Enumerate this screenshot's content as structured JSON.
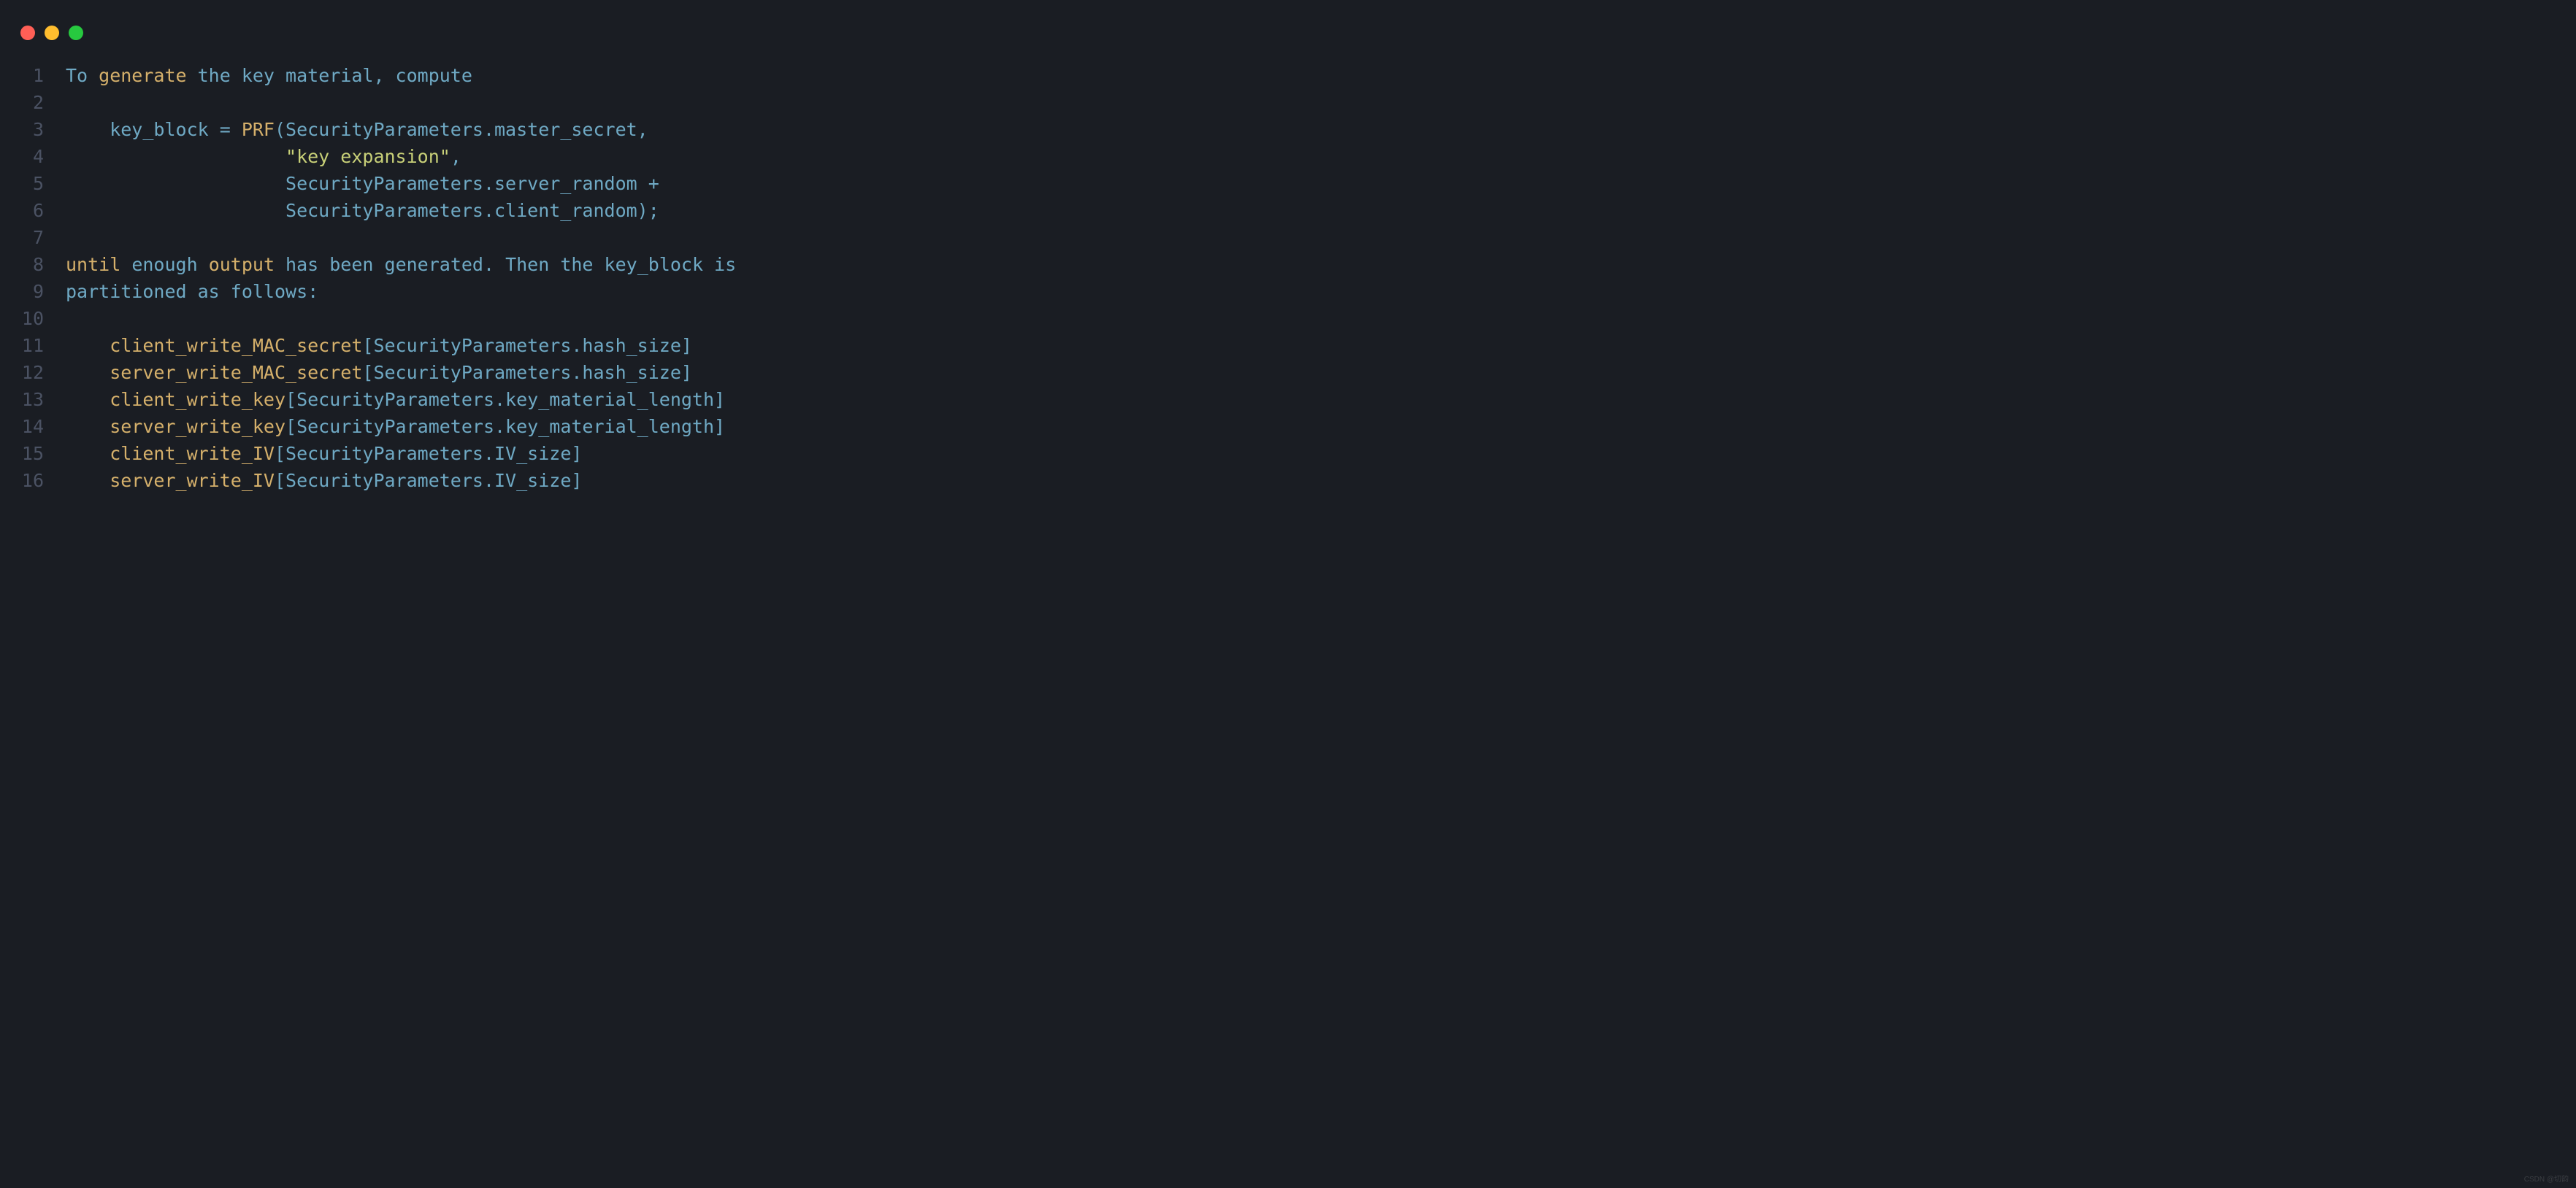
{
  "colors": {
    "bg": "#1a1d23",
    "red": "#ff5f56",
    "yellow": "#ffbd2e",
    "green": "#27c93f",
    "gutter": "#4b5263",
    "default": "#6fa9c4",
    "keyword": "#d5b06b",
    "string": "#c8d078"
  },
  "line_count": 16,
  "lines": {
    "l1": {
      "s1": "To ",
      "s2": "generate",
      "s3": " the key material, compute"
    },
    "l2": {
      "s1": ""
    },
    "l3": {
      "s1": "    key_block = ",
      "s2": "PRF",
      "s3": "(SecurityParameters.master_secret,"
    },
    "l4": {
      "s1": "                    ",
      "s2": "\"key expansion\"",
      "s3": ","
    },
    "l5": {
      "s1": "                    SecurityParameters.server_random +"
    },
    "l6": {
      "s1": "                    SecurityParameters.client_random);"
    },
    "l7": {
      "s1": ""
    },
    "l8": {
      "s1": "until",
      "s2": " enough ",
      "s3": "output",
      "s4": " has been generated. Then the key_block is"
    },
    "l9": {
      "s1": "partitioned as follows:"
    },
    "l10": {
      "s1": ""
    },
    "l11": {
      "s1": "    client_write_MAC_secret",
      "s2": "[SecurityParameters.hash_size]"
    },
    "l12": {
      "s1": "    server_write_MAC_secret",
      "s2": "[SecurityParameters.hash_size]"
    },
    "l13": {
      "s1": "    client_write_key",
      "s2": "[SecurityParameters.key_material_length]"
    },
    "l14": {
      "s1": "    server_write_key",
      "s2": "[SecurityParameters.key_material_length]"
    },
    "l15": {
      "s1": "    client_write_IV",
      "s2": "[SecurityParameters.IV_size]"
    },
    "l16": {
      "s1": "    server_write_IV",
      "s2": "[SecurityParameters.IV_size]"
    }
  },
  "line_numbers": {
    "n1": "1",
    "n2": "2",
    "n3": "3",
    "n4": "4",
    "n5": "5",
    "n6": "6",
    "n7": "7",
    "n8": "8",
    "n9": "9",
    "n10": "10",
    "n11": "11",
    "n12": "12",
    "n13": "13",
    "n14": "14",
    "n15": "15",
    "n16": "16"
  },
  "watermark": "CSDN @切韵"
}
